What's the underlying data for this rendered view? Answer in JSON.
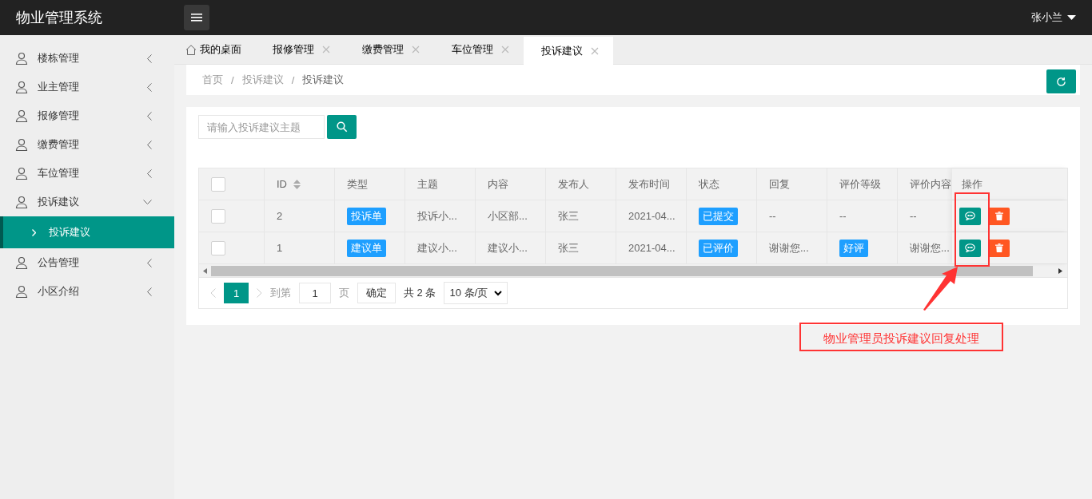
{
  "app": {
    "title": "物业管理系统",
    "user": "张小兰"
  },
  "sidebar": {
    "items": [
      {
        "label": "楼栋管理",
        "expanded": false
      },
      {
        "label": "业主管理",
        "expanded": false
      },
      {
        "label": "报修管理",
        "expanded": false
      },
      {
        "label": "缴费管理",
        "expanded": false
      },
      {
        "label": "车位管理",
        "expanded": false
      },
      {
        "label": "投诉建议",
        "expanded": true,
        "children": [
          {
            "label": "投诉建议",
            "selected": true
          }
        ]
      },
      {
        "label": "公告管理",
        "expanded": false
      },
      {
        "label": "小区介绍",
        "expanded": false
      }
    ]
  },
  "tabs": [
    {
      "label": "我的桌面",
      "kind": "home",
      "selected": false
    },
    {
      "label": "报修管理",
      "kind": "closable",
      "selected": false
    },
    {
      "label": "缴费管理",
      "kind": "closable",
      "selected": false
    },
    {
      "label": "车位管理",
      "kind": "closable",
      "selected": false
    },
    {
      "label": "投诉建议",
      "kind": "closable",
      "selected": true
    }
  ],
  "breadcrumb": {
    "items": [
      "首页",
      "投诉建议",
      "投诉建议"
    ],
    "separator": "/"
  },
  "search": {
    "placeholder": "请输入投诉建议主题"
  },
  "table": {
    "select_all_checked": false,
    "columns": [
      "ID",
      "类型",
      "主题",
      "内容",
      "发布人",
      "发布时间",
      "状态",
      "回复",
      "评价等级",
      "评价内容"
    ],
    "action_column": "操作",
    "rows": [
      {
        "checked": false,
        "cells": [
          {
            "kind": "text",
            "text": "2"
          },
          {
            "kind": "tag",
            "text": "投诉单"
          },
          {
            "kind": "text",
            "text": "投诉小..."
          },
          {
            "kind": "text",
            "text": "小区部..."
          },
          {
            "kind": "text",
            "text": "张三"
          },
          {
            "kind": "text",
            "text": "2021-04..."
          },
          {
            "kind": "tag",
            "text": "已提交"
          },
          {
            "kind": "text",
            "text": "--"
          },
          {
            "kind": "text",
            "text": "--"
          },
          {
            "kind": "text",
            "text": "--"
          }
        ]
      },
      {
        "checked": false,
        "cells": [
          {
            "kind": "text",
            "text": "1"
          },
          {
            "kind": "tag",
            "text": "建议单"
          },
          {
            "kind": "text",
            "text": "建议小..."
          },
          {
            "kind": "text",
            "text": "建议小..."
          },
          {
            "kind": "text",
            "text": "张三"
          },
          {
            "kind": "text",
            "text": "2021-04..."
          },
          {
            "kind": "tag",
            "text": "已评价"
          },
          {
            "kind": "text",
            "text": "谢谢您..."
          },
          {
            "kind": "tag",
            "text": "好评"
          },
          {
            "kind": "text",
            "text": "谢谢您..."
          }
        ]
      }
    ]
  },
  "pager": {
    "page": "1",
    "goto_label": "到第",
    "goto_value": "1",
    "page_unit": "页",
    "confirm": "确定",
    "total": "共 2 条",
    "page_size": "10 条/页"
  },
  "annotation": {
    "text": "物业管理员投诉建议回复处理"
  }
}
